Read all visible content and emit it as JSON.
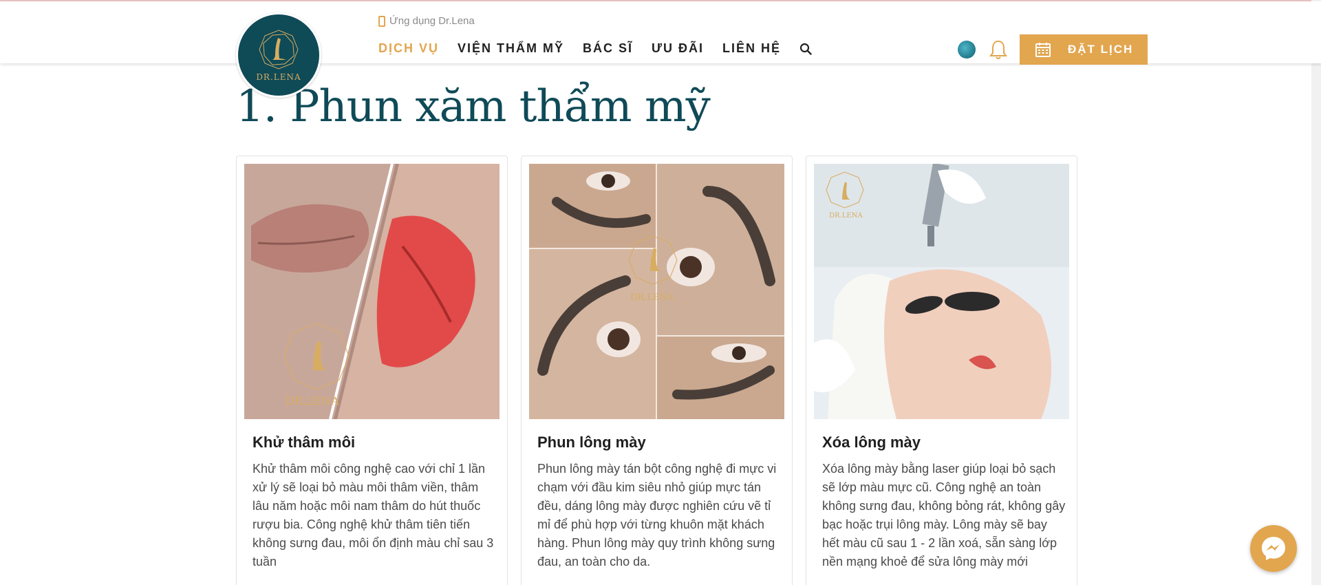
{
  "brand": {
    "logo_text": "DR.LENA",
    "app_link": "Ứng dụng Dr.Lena",
    "accent_color": "#e2a64f",
    "primary_color": "#0f4a57"
  },
  "nav": {
    "items": [
      {
        "label": "DỊCH VỤ",
        "active": true
      },
      {
        "label": "VIỆN THẨM MỸ",
        "active": false
      },
      {
        "label": "BÁC SĨ",
        "active": false
      },
      {
        "label": "ƯU ĐÃI",
        "active": false
      },
      {
        "label": "LIÊN HỆ",
        "active": false
      }
    ],
    "search_icon": "search-icon",
    "book_label": "ĐẶT LỊCH"
  },
  "section": {
    "title": "1. Phun xăm thẩm mỹ"
  },
  "cards": [
    {
      "title": "Khử thâm môi",
      "desc": "Khử thâm môi công nghệ cao với chỉ 1 lần xử lý sẽ loại bỏ màu môi thâm viền, thâm lâu năm hoặc môi nam thâm do hút thuốc rượu bia. Công nghệ khử thâm tiên tiến không sưng đau, môi ổn định màu chỉ sau 3 tuần"
    },
    {
      "title": "Phun lông mày",
      "desc": "Phun lông mày tán bột công nghệ đi mực vi chạm với đầu kim siêu nhỏ giúp mực tán đều, dáng lông mày được nghiên cứu vẽ tỉ mỉ để phù hợp với từng khuôn mặt khách hàng. Phun lông mày quy trình không sưng đau, an toàn cho da."
    },
    {
      "title": "Xóa lông mày",
      "desc": "Xóa lông mày bằng laser giúp loại bỏ sạch sẽ lớp màu mực cũ. Công nghệ an toàn không sưng đau, không bỏng rát, không gây bạc hoặc trụi lông mày. Lông mày sẽ bay hết màu cũ sau 1 - 2 lần xoá, sẵn sàng lớp nền mạng khoẻ để sửa lông mày mới"
    }
  ],
  "icons": {
    "bell": "bell-icon",
    "globe": "globe-icon",
    "calendar": "calendar-icon",
    "messenger": "messenger-icon"
  }
}
